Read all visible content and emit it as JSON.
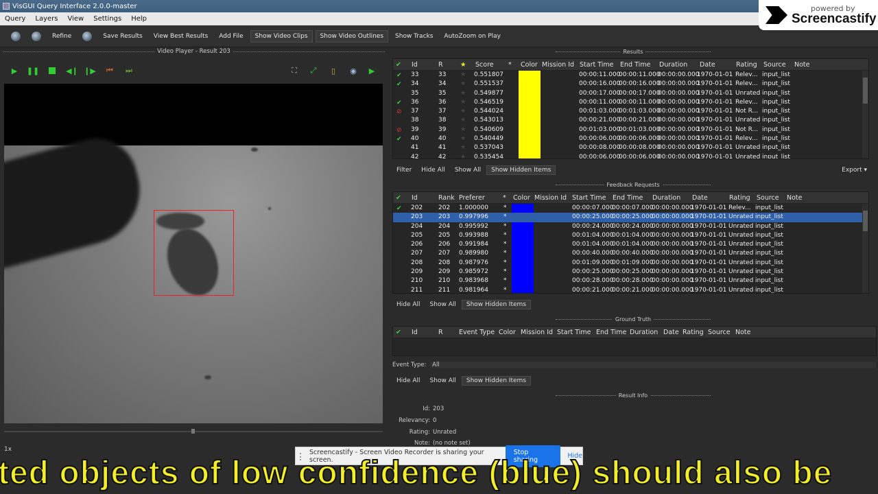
{
  "window": {
    "title": "VisGUI Query Interface 2.0.0-master"
  },
  "menu": [
    "Query",
    "Layers",
    "View",
    "Settings",
    "Help"
  ],
  "toolbar": {
    "buttons": [
      "Refine",
      "Save Results",
      "View Best Results",
      "Add File",
      "Show Video Clips",
      "Show Video Outlines",
      "Show Tracks",
      "AutoZoom on Play"
    ]
  },
  "brand": {
    "line1": "powered by",
    "line2": "Screencastify"
  },
  "video": {
    "title": "Video Player - Result 203",
    "speed": "1x"
  },
  "results": {
    "title": "Results",
    "columns": [
      "Id",
      "R",
      "★",
      "Score",
      "*",
      "Color",
      "Mission Id",
      "Start Time",
      "End Time",
      "Duration",
      "Date",
      "Rating",
      "Source",
      "Note"
    ],
    "rows": [
      {
        "mark": "check",
        "id": "33",
        "rank": "33",
        "score": "0.551807",
        "start": "00:00:11.000",
        "end": "00:00:11.000",
        "duration": "00:00:00.000",
        "date": "1970-01-01",
        "rating": "Relev...",
        "source": "input_list"
      },
      {
        "mark": "check",
        "id": "34",
        "rank": "34",
        "score": "0.551537",
        "start": "00:00:16.000",
        "end": "00:00:16.000",
        "duration": "00:00:00.000",
        "date": "1970-01-01",
        "rating": "Relev...",
        "source": "input_list"
      },
      {
        "mark": "",
        "id": "35",
        "rank": "35",
        "score": "0.549877",
        "start": "00:00:17.000",
        "end": "00:00:17.000",
        "duration": "00:00:00.000",
        "date": "1970-01-01",
        "rating": "Unrated",
        "source": "input_list"
      },
      {
        "mark": "check",
        "id": "36",
        "rank": "36",
        "score": "0.546519",
        "start": "00:00:11.000",
        "end": "00:00:11.000",
        "duration": "00:00:00.000",
        "date": "1970-01-01",
        "rating": "Relev...",
        "source": "input_list"
      },
      {
        "mark": "x",
        "id": "37",
        "rank": "37",
        "score": "0.544024",
        "start": "00:01:03.000",
        "end": "00:01:03.000",
        "duration": "00:00:00.000",
        "date": "1970-01-01",
        "rating": "Not R...",
        "source": "input_list"
      },
      {
        "mark": "",
        "id": "38",
        "rank": "38",
        "score": "0.543013",
        "start": "00:00:21.000",
        "end": "00:00:21.000",
        "duration": "00:00:00.000",
        "date": "1970-01-01",
        "rating": "Unrated",
        "source": "input_list"
      },
      {
        "mark": "x",
        "id": "39",
        "rank": "39",
        "score": "0.540609",
        "start": "00:01:03.000",
        "end": "00:01:03.000",
        "duration": "00:00:00.000",
        "date": "1970-01-01",
        "rating": "Not R...",
        "source": "input_list"
      },
      {
        "mark": "check",
        "id": "40",
        "rank": "40",
        "score": "0.540449",
        "start": "00:00:06.000",
        "end": "00:00:06.000",
        "duration": "00:00:00.000",
        "date": "1970-01-01",
        "rating": "Relev...",
        "source": "input_list"
      },
      {
        "mark": "",
        "id": "41",
        "rank": "41",
        "score": "0.537043",
        "start": "00:00:08.000",
        "end": "00:00:08.000",
        "duration": "00:00:00.000",
        "date": "1970-01-01",
        "rating": "Unrated",
        "source": "input_list"
      },
      {
        "mark": "",
        "id": "42",
        "rank": "42",
        "score": "0.535454",
        "start": "00:00:06.000",
        "end": "00:00:06.000",
        "duration": "00:00:00.000",
        "date": "1970-01-01",
        "rating": "Unrated",
        "source": "input_list"
      }
    ],
    "color": "#ffff00",
    "buttons": [
      "Filter",
      "Hide All",
      "Show All",
      "Show Hidden Items"
    ],
    "export": "Export"
  },
  "feedback": {
    "title": "Feedback Requests",
    "columns": [
      "Id",
      "Rank",
      "Preferer",
      "*",
      "Color",
      "Mission Id",
      "Start Time",
      "End Time",
      "Duration",
      "Date",
      "Rating",
      "Source",
      "Note"
    ],
    "rows": [
      {
        "mark": "check",
        "id": "202",
        "rank": "202",
        "pref": "1.000000",
        "star": "*",
        "start": "00:00:07.000",
        "end": "00:00:07.000",
        "duration": "00:00:00.000",
        "date": "1970-01-01",
        "rating": "Relev...",
        "source": "input_list"
      },
      {
        "mark": "",
        "id": "203",
        "rank": "203",
        "pref": "0.997996",
        "star": "*",
        "start": "00:00:25.000",
        "end": "00:00:25.000",
        "duration": "00:00:00.000",
        "date": "1970-01-01",
        "rating": "Unrated",
        "source": "input_list"
      },
      {
        "mark": "",
        "id": "204",
        "rank": "204",
        "pref": "0.995992",
        "star": "*",
        "start": "00:00:24.000",
        "end": "00:00:24.000",
        "duration": "00:00:00.000",
        "date": "1970-01-01",
        "rating": "Unrated",
        "source": "input_list"
      },
      {
        "mark": "",
        "id": "205",
        "rank": "205",
        "pref": "0.993988",
        "star": "*",
        "start": "00:01:04.000",
        "end": "00:01:04.000",
        "duration": "00:00:00.000",
        "date": "1970-01-01",
        "rating": "Unrated",
        "source": "input_list"
      },
      {
        "mark": "",
        "id": "206",
        "rank": "206",
        "pref": "0.991984",
        "star": "*",
        "start": "00:01:04.000",
        "end": "00:01:04.000",
        "duration": "00:00:00.000",
        "date": "1970-01-01",
        "rating": "Unrated",
        "source": "input_list"
      },
      {
        "mark": "",
        "id": "207",
        "rank": "207",
        "pref": "0.989980",
        "star": "*",
        "start": "00:00:40.000",
        "end": "00:00:40.000",
        "duration": "00:00:00.000",
        "date": "1970-01-01",
        "rating": "Unrated",
        "source": "input_list"
      },
      {
        "mark": "",
        "id": "208",
        "rank": "208",
        "pref": "0.987976",
        "star": "*",
        "start": "00:01:09.000",
        "end": "00:01:09.000",
        "duration": "00:00:00.000",
        "date": "1970-01-01",
        "rating": "Unrated",
        "source": "input_list"
      },
      {
        "mark": "",
        "id": "209",
        "rank": "209",
        "pref": "0.985972",
        "star": "*",
        "start": "00:00:25.000",
        "end": "00:00:25.000",
        "duration": "00:00:00.000",
        "date": "1970-01-01",
        "rating": "Unrated",
        "source": "input_list"
      },
      {
        "mark": "",
        "id": "210",
        "rank": "210",
        "pref": "0.983968",
        "star": "*",
        "start": "00:00:28.000",
        "end": "00:00:28.000",
        "duration": "00:00:00.000",
        "date": "1970-01-01",
        "rating": "Unrated",
        "source": "input_list"
      },
      {
        "mark": "",
        "id": "211",
        "rank": "211",
        "pref": "0.981964",
        "star": "*",
        "start": "00:00:21.000",
        "end": "00:00:21.000",
        "duration": "00:00:00.000",
        "date": "1970-01-01",
        "rating": "Unrated",
        "source": "input_list"
      }
    ],
    "selected_id": "203",
    "color": "#0000ff",
    "buttons": [
      "Hide All",
      "Show All",
      "Show Hidden Items"
    ]
  },
  "ground_truth": {
    "title": "Ground Truth",
    "columns": [
      "Id",
      "R",
      "Event Type",
      "Color",
      "Mission Id",
      "Start Time",
      "End Time",
      "Duration",
      "Date",
      "Rating",
      "Source",
      "Note"
    ],
    "event_type_label": "Event Type:",
    "event_type_value": "All",
    "buttons": [
      "Hide All",
      "Show All",
      "Show Hidden Items"
    ]
  },
  "result_info": {
    "title": "Result Info",
    "id_label": "Id:",
    "id": "203",
    "relevancy_label": "Relevancy:",
    "relevancy": "0",
    "rating_label": "Rating:",
    "rating": "Unrated",
    "note_label": "Note:",
    "note": "(no note set)"
  },
  "share_bar": {
    "text": "Screencastify - Screen Video Recorder is sharing your screen.",
    "stop": "Stop sharing",
    "hide": "Hide"
  },
  "caption": "ted objects of low confidence (blue) should also be"
}
